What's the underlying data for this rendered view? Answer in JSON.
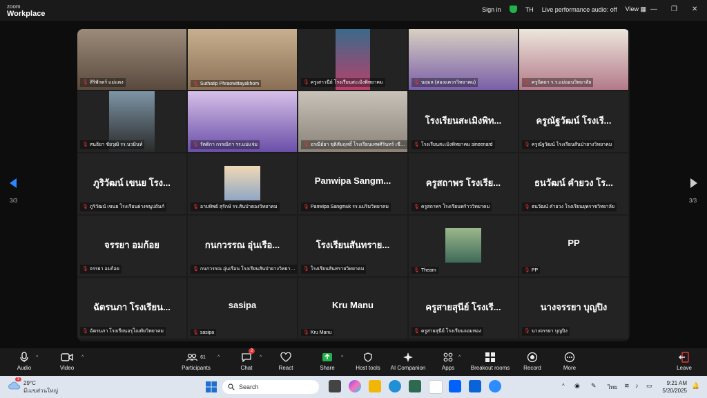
{
  "app": {
    "brand_small": "zoom",
    "brand_big": "Workplace"
  },
  "topbar": {
    "sign_in": "Sign in",
    "lang": "TH",
    "audio_status": "Live performance audio: off",
    "view": "View"
  },
  "pager": {
    "left": "3/3",
    "right": "3/3"
  },
  "tiles": [
    {
      "big": "",
      "label": "สิริพักตร์ แม่แตง"
    },
    {
      "big": "",
      "label": "Suthatip   Phraowittayakhom"
    },
    {
      "big": "",
      "label": "ครูเสาวนีย์ โรงเรียนสะเมิงพิทยาคม"
    },
    {
      "big": "",
      "label": "นฤมล (สองแควรวิทยาคม)"
    },
    {
      "big": "",
      "label": "ครูนิตยา ร.ร.แม่ออนวิทยาลัย"
    },
    {
      "big": "",
      "label": "สนธิยา ชัยวุฒิ รร.นวมินท์"
    },
    {
      "big": "",
      "label": "รัตติกา กรรณิกา รร.แม่แจ่ม"
    },
    {
      "big": "",
      "label": "อรณีย์ยา ชุติสัมฤทธิ์ โรงเรียนเทพศิรินทร์ เชียงใหม่"
    },
    {
      "big": "โรงเรียนสะเมิงพิท...",
      "label": "โรงเรียนสะเมิงพิทยาคม sineenard"
    },
    {
      "big": "ครูณัฐวัฒน์ โรงเรี...",
      "label": "ครูณัฐวัฒน์ โรงเรียนสันป่ายางวิทยาคม"
    },
    {
      "big": "ภูริวัฒน์ เขนย โรง...",
      "label": "ภูริวัฒน์ เขนย โรงเรียนฝางชนูปถัมภ์"
    },
    {
      "big": "",
      "label": "อาบทิพย์ สุรักษ์ รร.สันป่าตองวิทยาคม"
    },
    {
      "big": "Panwipa  Sangm...",
      "label": "Panwipa Sangmuk รร.แม่ริมวิทยาคม"
    },
    {
      "big": "ครูสถาพร โรงเรีย...",
      "label": "ครูสถาพร โรงเรียนพร้าววิทยาคม"
    },
    {
      "big": "ธนวัฒน์ คำยวง โร...",
      "label": "ธนวัฒน์ คำยวง โรงเรียนยุพราชวิทยาลัย"
    },
    {
      "big": "จรรยา อมก้อย",
      "label": "จรรยา อมก้อย"
    },
    {
      "big": "กนกวรรณ อุ่นเรือ...",
      "label": "กนกวรรณ อุ่นเรือน โรงเรียนสันป่ายางวิทยาคม"
    },
    {
      "big": "โรงเรียนสันทราย...",
      "label": "โรงเรียนสันทรายวิทยาคม"
    },
    {
      "big": "",
      "label": "Theam"
    },
    {
      "big": "PP",
      "label": "PP"
    },
    {
      "big": "ฉัตรนภา โรงเรียน...",
      "label": "ฉัตรนภา โรงเรียนอรุโณทัยวิทยาคม"
    },
    {
      "big": "sasipa",
      "label": "sasipa"
    },
    {
      "big": "Kru Manu",
      "label": "Kru Manu"
    },
    {
      "big": "ครูสายสุนีย์ โรงเรี...",
      "label": "ครูสายสุนีย์ โรงเรียนจอมทอง"
    },
    {
      "big": "นางจรรยา บุญปิง",
      "label": "นางจรรยา บุญปิง"
    }
  ],
  "toolbar": {
    "audio": "Audio",
    "video": "Video",
    "participants": "Participants",
    "participants_count": "61",
    "chat": "Chat",
    "chat_badge": "2",
    "react": "React",
    "share": "Share",
    "host_tools": "Host tools",
    "ai_companion": "AI Companion",
    "apps": "Apps",
    "breakout": "Breakout rooms",
    "record": "Record",
    "more": "More",
    "leave": "Leave"
  },
  "taskbar": {
    "weather_badge": "3",
    "temp": "29°C",
    "weather_desc": "มีเมฆส่วนใหญ่",
    "search": "Search",
    "lang": "ไทย",
    "time": "9:21 AM",
    "date": "5/20/2025"
  },
  "colors": {
    "accent_green": "#22b14c",
    "leave_red": "#e03a3a",
    "tile_bg": "#232323"
  }
}
